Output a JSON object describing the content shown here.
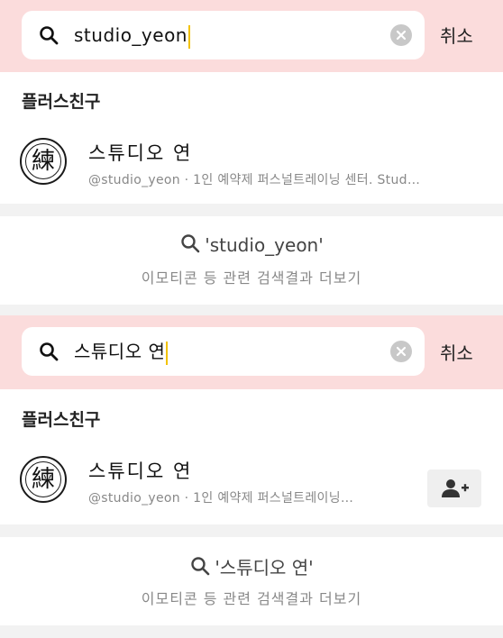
{
  "panels": [
    {
      "search": {
        "query": "studio_yeon",
        "cancel_label": "취소"
      },
      "section_title": "플러스친구",
      "friend": {
        "avatar_glyph": "練",
        "name": "스튜디오 연",
        "subtitle": "@studio_yeon · 1인 예약제 퍼스널트레이닝 센터. Stud…"
      },
      "more": {
        "query_label": "'studio_yeon'",
        "caption": "이모티콘 등 관련 검색결과 더보기"
      }
    },
    {
      "search": {
        "query": "스튜디오 연",
        "cancel_label": "취소"
      },
      "section_title": "플러스친구",
      "friend": {
        "avatar_glyph": "練",
        "name": "스튜디오 연",
        "subtitle": "@studio_yeon · 1인 예약제 퍼스널트레이닝…",
        "add_icon": "add-friend-icon"
      },
      "more": {
        "query_label": "'스튜디오 연'",
        "caption": "이모티콘 등 관련 검색결과 더보기"
      }
    }
  ],
  "colors": {
    "search_bar_bg": "#fbdcdc",
    "caret": "#f2c200",
    "clear_button": "#c8c8c8",
    "separator": "#f2f2f2",
    "subtext": "#888888"
  }
}
